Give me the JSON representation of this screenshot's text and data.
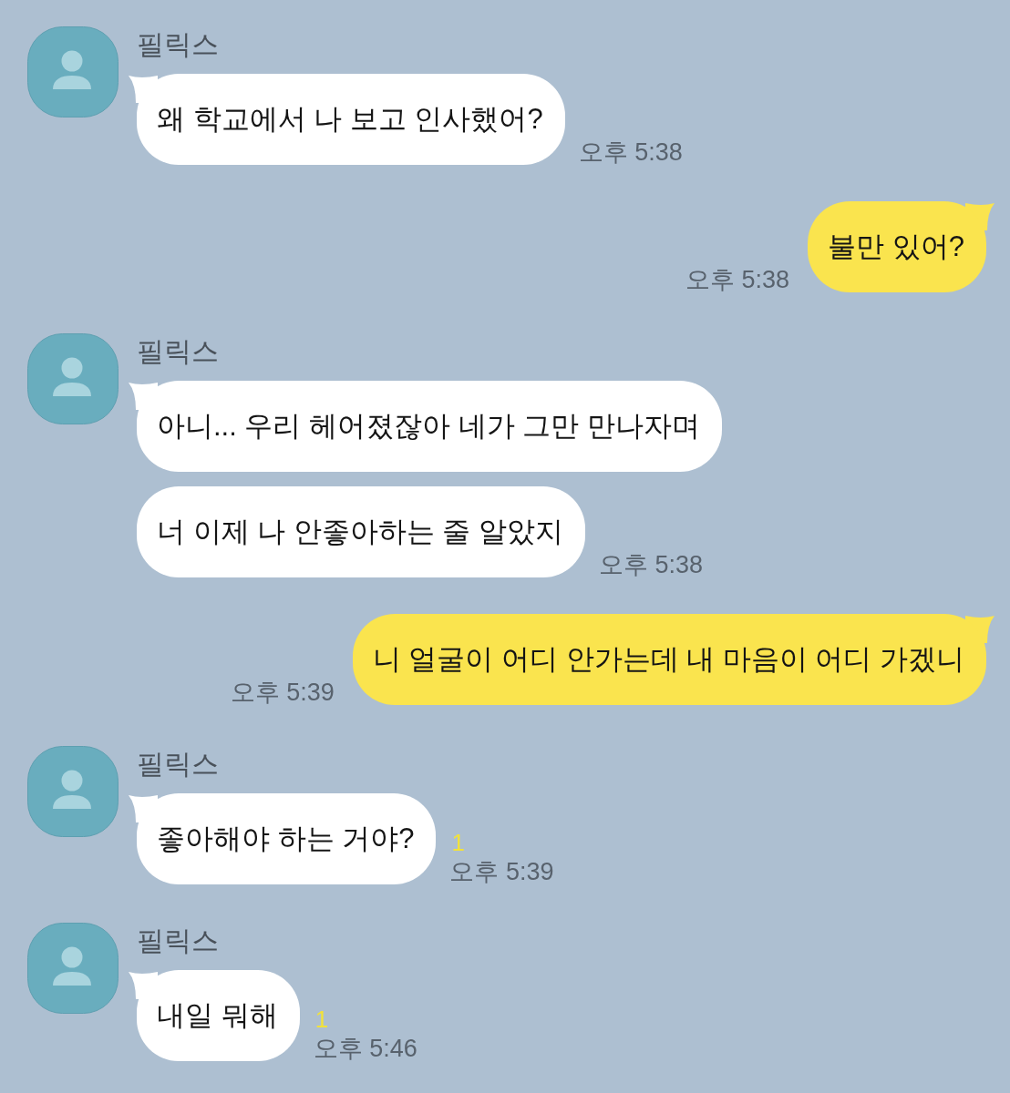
{
  "chat": {
    "messages": [
      {
        "kind": "received",
        "sender": "필릭스",
        "bubbles": [
          "왜 학교에서 나 보고 인사했어?"
        ],
        "time": "오후 5:38"
      },
      {
        "kind": "sent",
        "bubbles": [
          "불만 있어?"
        ],
        "time": "오후 5:38"
      },
      {
        "kind": "received",
        "sender": "필릭스",
        "bubbles": [
          "아니... 우리 헤어졌잖아 네가 그만 만나자며",
          "너 이제 나 안좋아하는 줄 알았지"
        ],
        "time": "오후 5:38"
      },
      {
        "kind": "sent",
        "bubbles": [
          "니 얼굴이 어디 안가는데 내 마음이 어디 가겠니"
        ],
        "time": "오후 5:39"
      },
      {
        "kind": "received",
        "sender": "필릭스",
        "bubbles": [
          "좋아해야 하는 거야?"
        ],
        "unread": "1",
        "time": "오후 5:39"
      },
      {
        "kind": "received",
        "sender": "필릭스",
        "bubbles": [
          "내일 뭐해"
        ],
        "unread": "1",
        "time": "오후 5:46"
      }
    ]
  }
}
